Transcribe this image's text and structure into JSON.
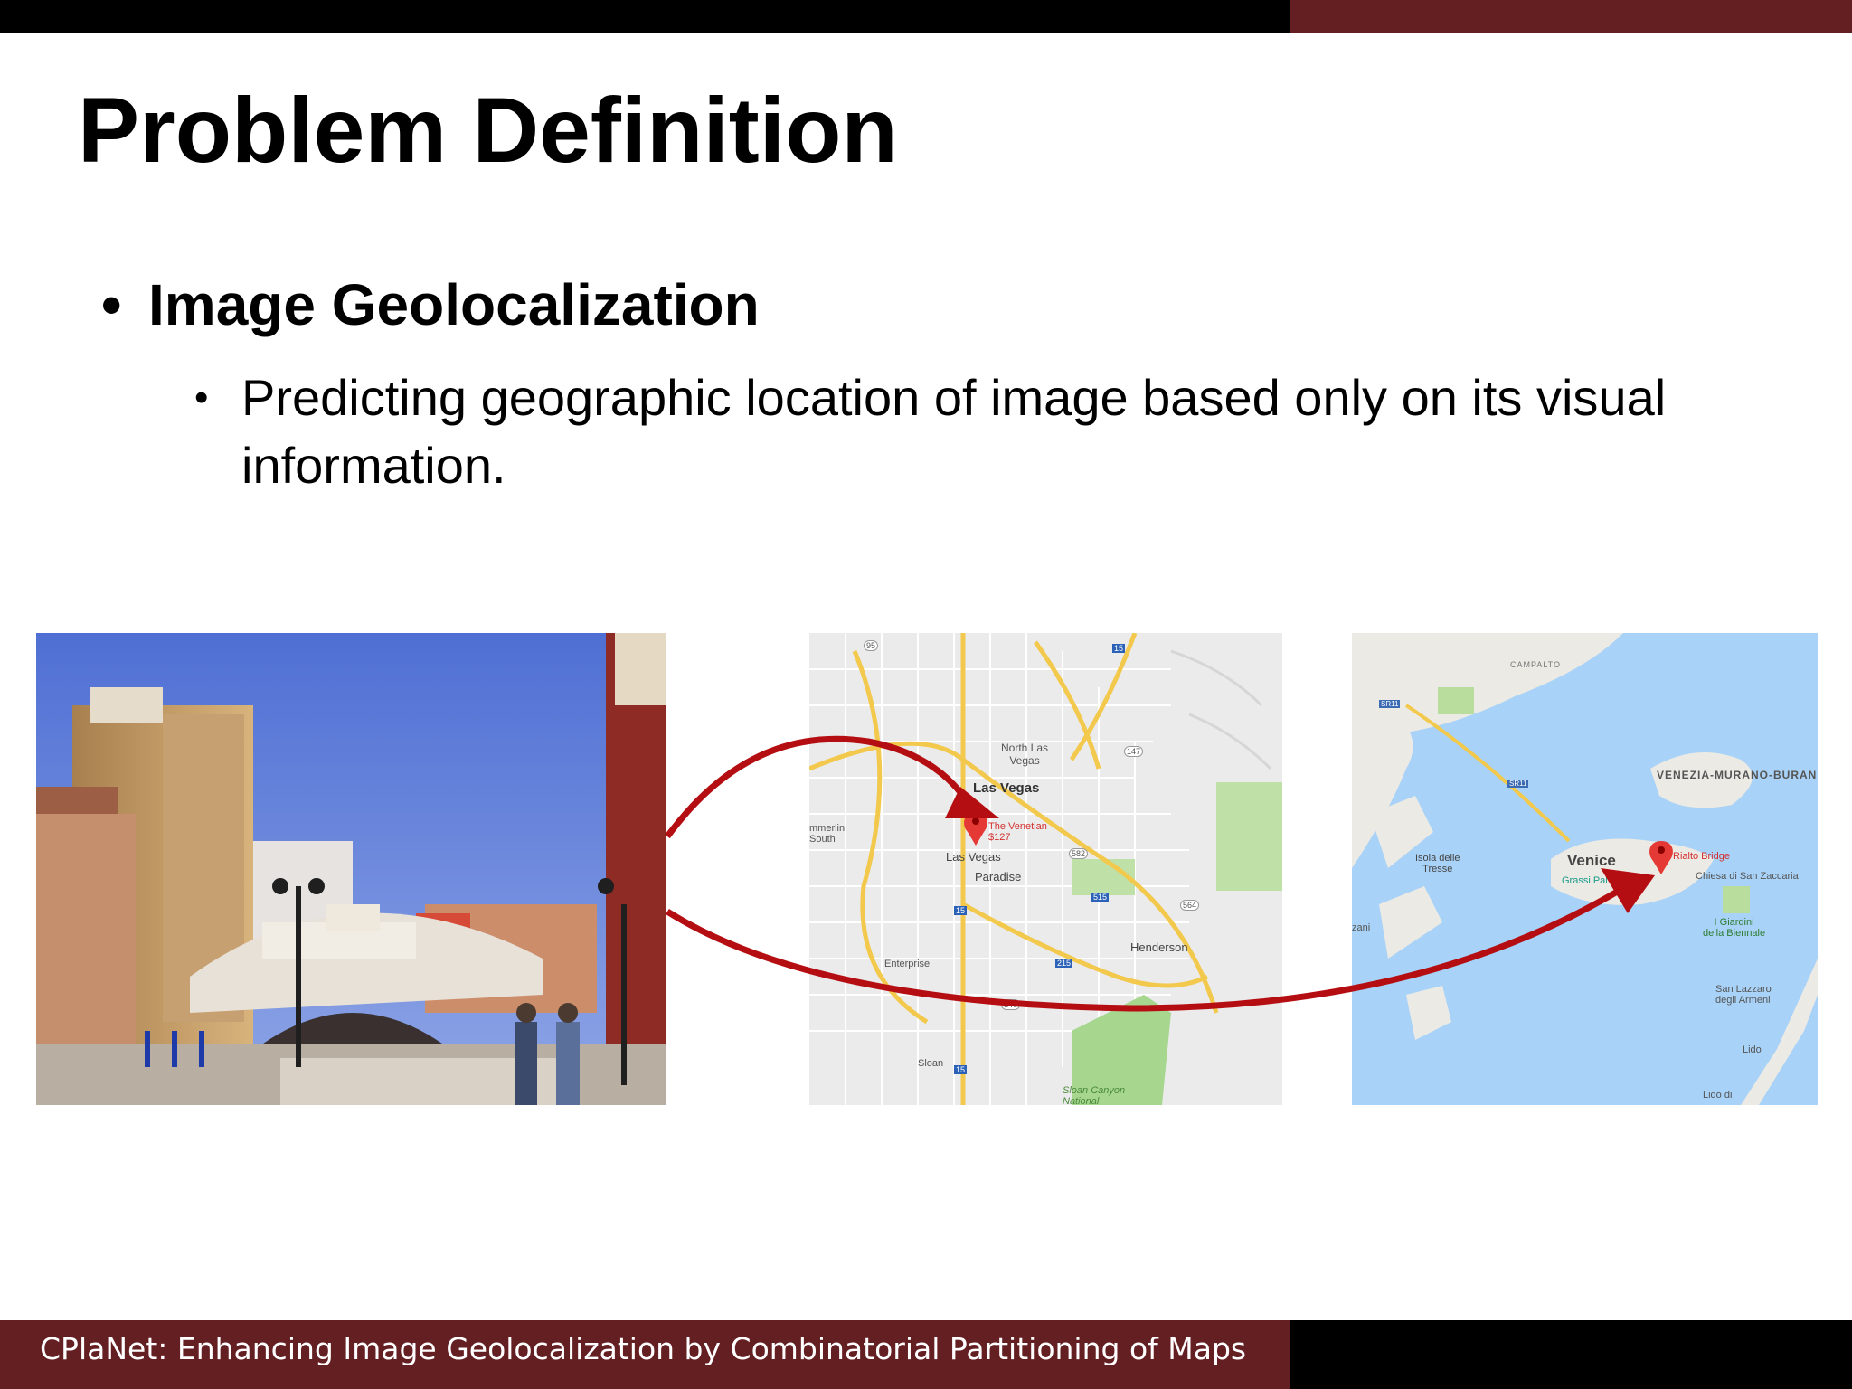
{
  "slide": {
    "title": "Problem Definition",
    "bullet_level1": "Image Geolocalization",
    "bullet_level2": "Predicting geographic location of image based only on its visual information.",
    "bullet_symbol": "•"
  },
  "colors": {
    "accent_maroon": "#641f22",
    "arrow_red": "#b50e12",
    "pin_red": "#e53935"
  },
  "maps": {
    "las_vegas": {
      "labels": {
        "north_las_vegas": "North Las\nVegas",
        "las_vegas_main": "Las Vegas",
        "las_vegas_small": "Las Vegas",
        "summerlin": "mmerlin\nSouth",
        "paradise": "Paradise",
        "enterprise": "Enterprise",
        "henderson": "Henderson",
        "sloan": "Sloan",
        "sloan_canyon": "Sloan Canyon\nNational",
        "venetian": "The Venetian",
        "venetian_price": "$127",
        "shield_95": "95",
        "shield_15": "15",
        "shield_147": "147",
        "shield_582": "582",
        "shield_515": "515",
        "shield_564": "564",
        "shield_215": "215",
        "shield_146": "146"
      }
    },
    "venice": {
      "labels": {
        "campalto": "CAMPALTO",
        "sr11_a": "SR11",
        "sr11_b": "SR11",
        "venezia_murano": "VENEZIA-MURANO-BURAN",
        "isola": "Isola delle\nTresse",
        "venice": "Venice",
        "grassi": "Grassi Pal",
        "rialto": "Rialto Bridge",
        "chiesa": "Chiesa di San Zaccaria",
        "giardini": "I Giardini\ndella Biennale",
        "san_lazzaro": "San Lazzaro\ndegli Armeni",
        "lido": "Lido",
        "lido_di": "Lido di",
        "zani": "zani"
      }
    }
  },
  "footer": {
    "text": "CPlaNet: Enhancing Image Geolocalization by Combinatorial Partitioning of Maps"
  }
}
